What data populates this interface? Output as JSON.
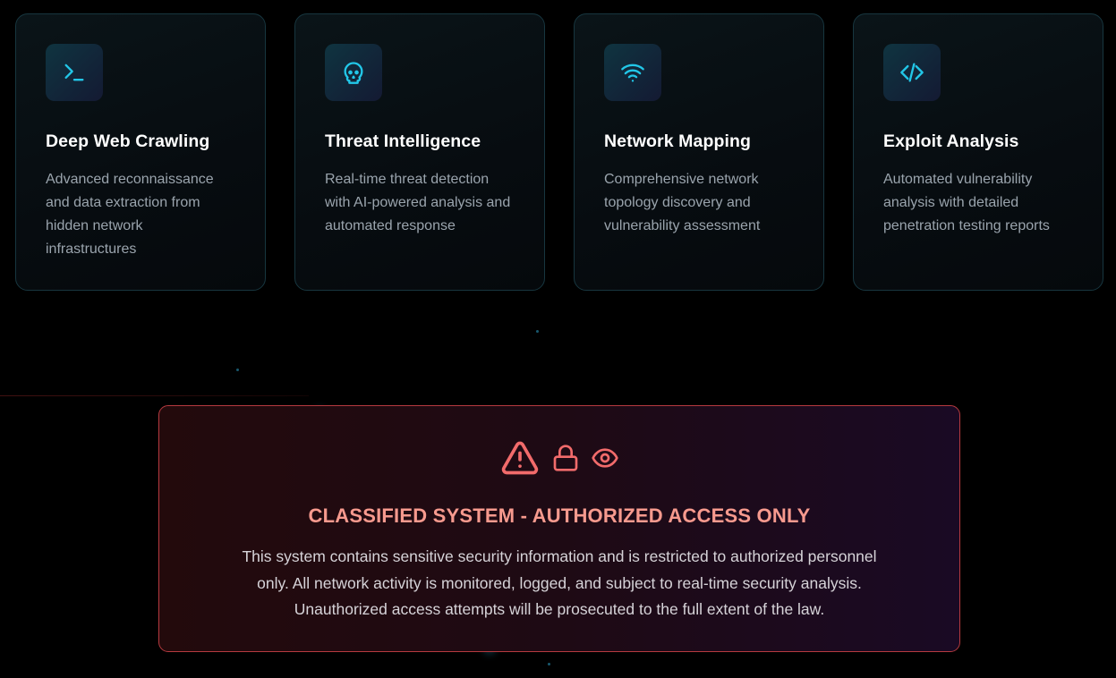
{
  "features": [
    {
      "icon": "terminal-icon",
      "title": "Deep Web Crawling",
      "description": "Advanced reconnaissance and data extraction from hidden network infrastructures"
    },
    {
      "icon": "skull-icon",
      "title": "Threat Intelligence",
      "description": "Real-time threat detection with AI-powered analysis and automated response"
    },
    {
      "icon": "wifi-icon",
      "title": "Network Mapping",
      "description": "Comprehensive network topology discovery and vulnerability assessment"
    },
    {
      "icon": "code-icon",
      "title": "Exploit Analysis",
      "description": "Automated vulnerability analysis with detailed penetration testing reports"
    }
  ],
  "warning": {
    "icons": [
      "alert-triangle-icon",
      "lock-icon",
      "eye-icon"
    ],
    "title": "CLASSIFIED SYSTEM - AUTHORIZED ACCESS ONLY",
    "line1": "This system contains sensitive security information and is restricted to authorized personnel",
    "line2": "only. All network activity is monitored, logged, and subject to real-time security analysis.",
    "line3": "Unauthorized access attempts will be prosecuted to the full extent of the law."
  },
  "colors": {
    "icon_accent": "#22c7e8",
    "warning_accent": "#f26b6b",
    "warning_title": "#f79a8e",
    "card_border": "#17363f",
    "warning_border": "#b63a3f"
  }
}
